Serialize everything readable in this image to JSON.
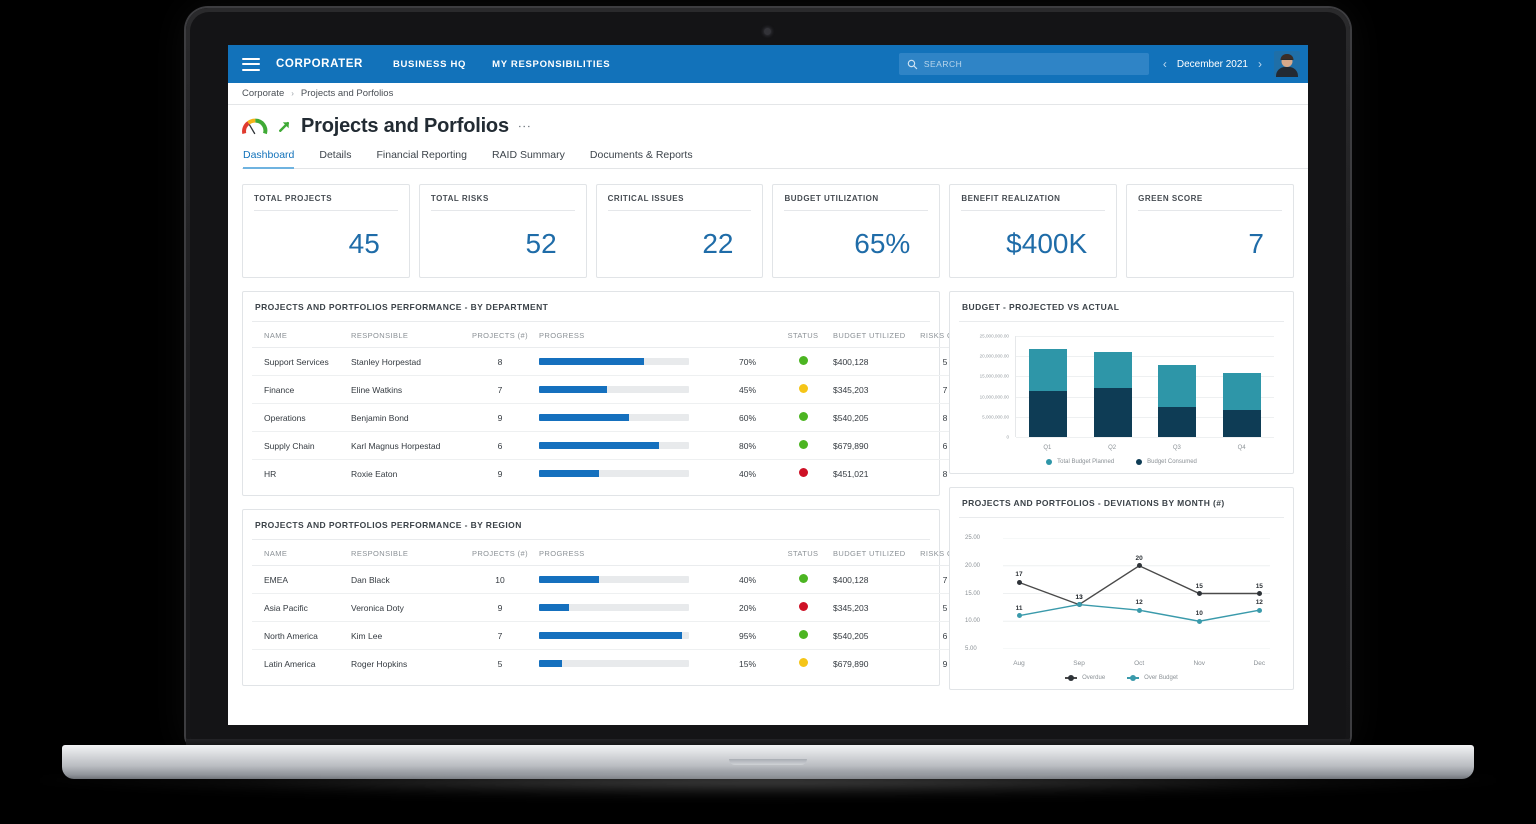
{
  "topnav": {
    "brand": "CORPORATER",
    "links": [
      {
        "label": "BUSINESS HQ"
      },
      {
        "label": "MY RESPONSIBILITIES"
      }
    ],
    "search_placeholder": "SEARCH",
    "search_value": "",
    "period": "December 2021",
    "prev_icon": "‹",
    "next_icon": "›"
  },
  "breadcrumb": {
    "items": [
      "Corporate",
      "Projects and Porfolios"
    ],
    "separator": "›"
  },
  "header": {
    "title": "Projects and Porfolios",
    "menu_icon": "⋮"
  },
  "tabs": [
    {
      "label": "Dashboard",
      "active": true
    },
    {
      "label": "Details",
      "active": false
    },
    {
      "label": "Financial Reporting",
      "active": false
    },
    {
      "label": "RAID Summary",
      "active": false
    },
    {
      "label": "Documents & Reports",
      "active": false
    }
  ],
  "kpis": [
    {
      "label": "TOTAL PROJECTS",
      "value": "45"
    },
    {
      "label": "TOTAL RISKS",
      "value": "52"
    },
    {
      "label": "CRITICAL ISSUES",
      "value": "22"
    },
    {
      "label": "BUDGET UTILIZATION",
      "value": "65%"
    },
    {
      "label": "BENEFIT REALIZATION",
      "value": "$400K"
    },
    {
      "label": "GREEN SCORE",
      "value": "7"
    }
  ],
  "colors": {
    "accent_blue": "#1272ba",
    "progress_blue": "#1570be",
    "status_green": "#4cb522",
    "status_yellow": "#f5c518",
    "status_red": "#ce1126",
    "bar_planned": "#2e96a8",
    "bar_consumed": "#0e3c55",
    "line_overdue": "#4a4a4a",
    "line_overbudget": "#3a9aab"
  },
  "department_table": {
    "title": "PROJECTS AND PORTFOLIOS PERFORMANCE - BY DEPARTMENT",
    "columns": [
      "NAME",
      "RESPONSIBLE",
      "PROJECTS (#)",
      "PROGRESS",
      "",
      "STATUS",
      "BUDGET UTILIZED",
      "RISKS OPEN",
      ""
    ],
    "rows": [
      {
        "name": "Support Services",
        "responsible": "Stanley Horpestad",
        "projects": "8",
        "progress": 70,
        "progress_label": "70%",
        "status": "green",
        "budget": "$400,128",
        "risks": "5",
        "menu": "⋮"
      },
      {
        "name": "Finance",
        "responsible": "Eline Watkins",
        "projects": "7",
        "progress": 45,
        "progress_label": "45%",
        "status": "yellow",
        "budget": "$345,203",
        "risks": "7",
        "menu": "⋮"
      },
      {
        "name": "Operations",
        "responsible": "Benjamin Bond",
        "projects": "9",
        "progress": 60,
        "progress_label": "60%",
        "status": "green",
        "budget": "$540,205",
        "risks": "8",
        "menu": "⋮"
      },
      {
        "name": "Supply Chain",
        "responsible": "Karl Magnus Horpestad",
        "projects": "6",
        "progress": 80,
        "progress_label": "80%",
        "status": "green",
        "budget": "$679,890",
        "risks": "6",
        "menu": "⋮"
      },
      {
        "name": "HR",
        "responsible": "Roxie Eaton",
        "projects": "9",
        "progress": 40,
        "progress_label": "40%",
        "status": "red",
        "budget": "$451,021",
        "risks": "8",
        "menu": "⋮"
      }
    ]
  },
  "region_table": {
    "title": "PROJECTS AND PORTFOLIOS PERFORMANCE - BY REGION",
    "columns": [
      "NAME",
      "RESPONSIBLE",
      "PROJECTS (#)",
      "PROGRESS",
      "",
      "STATUS",
      "BUDGET UTILIZED",
      "RISKS OPEN",
      ""
    ],
    "rows": [
      {
        "name": "EMEA",
        "responsible": "Dan Black",
        "projects": "10",
        "progress": 40,
        "progress_label": "40%",
        "status": "green",
        "budget": "$400,128",
        "risks": "7",
        "menu": "⋮"
      },
      {
        "name": "Asia Pacific",
        "responsible": "Veronica Doty",
        "projects": "9",
        "progress": 20,
        "progress_label": "20%",
        "status": "red",
        "budget": "$345,203",
        "risks": "5",
        "menu": "⋮"
      },
      {
        "name": "North America",
        "responsible": "Kim Lee",
        "projects": "7",
        "progress": 95,
        "progress_label": "95%",
        "status": "green",
        "budget": "$540,205",
        "risks": "6",
        "menu": "⋮"
      },
      {
        "name": "Latin America",
        "responsible": "Roger Hopkins",
        "projects": "5",
        "progress": 15,
        "progress_label": "15%",
        "status": "yellow",
        "budget": "$679,890",
        "risks": "9",
        "menu": "⋮"
      }
    ]
  },
  "chart_data": [
    {
      "type": "bar",
      "id": "budget_projected_vs_actual",
      "title": "BUDGET - PROJECTED VS ACTUAL",
      "stacked": true,
      "categories": [
        "Q1",
        "Q2",
        "Q3",
        "Q4"
      ],
      "series": [
        {
          "name": "Budget Consumed",
          "color": "#0e3c55",
          "values": [
            11500000,
            12200000,
            7500000,
            6700000
          ]
        },
        {
          "name": "Total Budget Planned",
          "color": "#2e96a8",
          "values": [
            21700000,
            21000000,
            17800000,
            15900000
          ]
        }
      ],
      "legend": [
        "Total Budget Planned",
        "Budget Consumed"
      ],
      "legend_position": "bottom",
      "ylim": [
        0,
        25000000
      ],
      "yticks": [
        0,
        5000000,
        10000000,
        15000000,
        20000000,
        25000000
      ],
      "ytick_labels": [
        "0",
        "5,000,000.00",
        "10,000,000.00",
        "15,000,000.00",
        "20,000,000.00",
        "25,000,000.00"
      ],
      "xlabel": "",
      "ylabel": "",
      "grid": true
    },
    {
      "type": "line",
      "id": "deviations_by_month",
      "title": "PROJECTS AND PORTFOLIOS - DEVIATIONS BY MONTH (#)",
      "x": [
        "Aug",
        "Sep",
        "Oct",
        "Nov",
        "Dec"
      ],
      "series": [
        {
          "name": "Overdue",
          "color": "#4a4a4a",
          "values": [
            17,
            13,
            20,
            15,
            15
          ]
        },
        {
          "name": "Over Budget",
          "color": "#3a9aab",
          "values": [
            11,
            13,
            12,
            10,
            12
          ]
        }
      ],
      "legend": [
        "Overdue",
        "Over Budget"
      ],
      "legend_position": "bottom",
      "ylim": [
        5,
        25
      ],
      "yticks": [
        5,
        10,
        15,
        20,
        25
      ],
      "ytick_labels": [
        "5.00",
        "10.00",
        "15.00",
        "20.00",
        "25.00"
      ],
      "xlabel": "",
      "ylabel": "",
      "grid": true,
      "data_labels": true
    }
  ]
}
